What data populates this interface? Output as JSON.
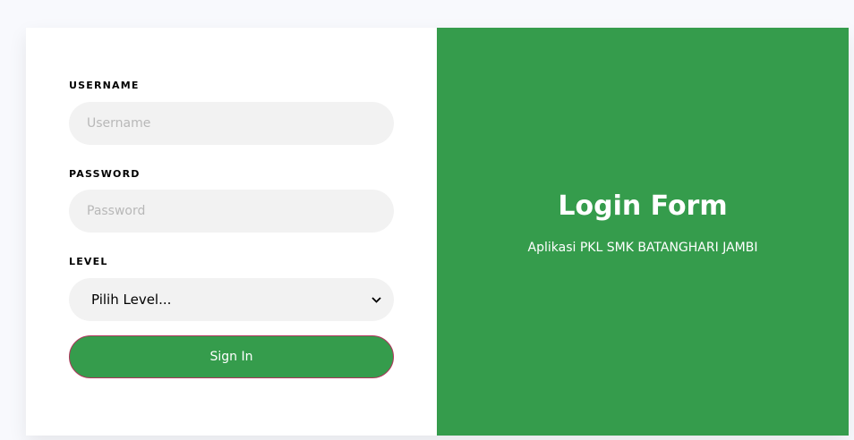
{
  "form": {
    "username": {
      "label": "USERNAME",
      "placeholder": "Username",
      "value": ""
    },
    "password": {
      "label": "PASSWORD",
      "placeholder": "Password",
      "value": ""
    },
    "level": {
      "label": "LEVEL",
      "selected": "Pilih Level..."
    },
    "submit_label": "Sign In"
  },
  "brand": {
    "title": "Login Form",
    "subtitle": "Aplikasi PKL SMK BATANGHARI JAMBI"
  },
  "colors": {
    "accent": "#359c4c",
    "button_border": "#b0345c",
    "input_bg": "#f2f2f2",
    "page_bg": "#f8f9fd"
  }
}
